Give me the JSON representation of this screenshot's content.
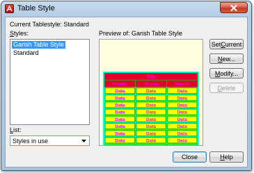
{
  "window": {
    "title": "Table Style"
  },
  "current_tablestyle": {
    "label": "Current Tablestyle:",
    "value": "Standard"
  },
  "styles": {
    "label_key": "S",
    "label_rest": "tyles:",
    "items": [
      {
        "label": "Garish Table Style",
        "selected": true
      },
      {
        "label": "Standard",
        "selected": false
      }
    ]
  },
  "list_filter": {
    "label_key": "L",
    "label_rest": "ist:",
    "selected": "Styles in use"
  },
  "preview": {
    "label_prefix": "Preview of:",
    "style_name": "Garish Table Style",
    "table": {
      "title": "Title",
      "headers": [
        "Header",
        "Header",
        "Header"
      ],
      "cell_text": "Data",
      "data_rows": 9,
      "colors": {
        "background": "#ffffe0",
        "outer_border": "#00ffff",
        "title_fill": "#e0002a",
        "header_fill": "#e0002a",
        "data_fill": "#ffff00",
        "text": "#ff00ff",
        "grid": "#00cc00"
      }
    }
  },
  "buttons": {
    "set_current": {
      "before": "Set ",
      "key": "C",
      "after": "urrent"
    },
    "new": {
      "before": "",
      "key": "N",
      "after": "ew..."
    },
    "modify": {
      "before": "",
      "key": "M",
      "after": "odify..."
    },
    "delete": {
      "before": "",
      "key": "D",
      "after": "elete"
    },
    "close": {
      "label": "Close"
    },
    "help": {
      "before": "",
      "key": "H",
      "after": "elp"
    }
  }
}
